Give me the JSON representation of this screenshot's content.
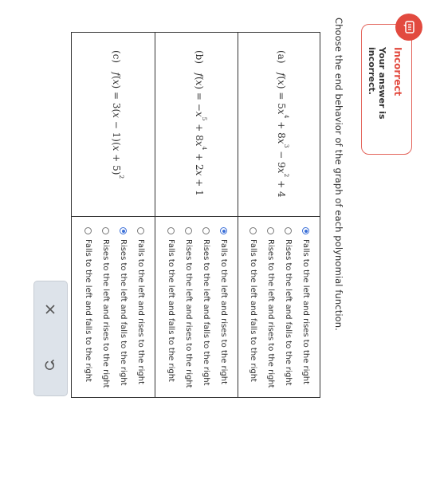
{
  "feedback": {
    "title": "Incorrect",
    "message": "Your answer is incorrect.",
    "icon": "speech-bubble-icon",
    "accent": "#e24a3f"
  },
  "prompt": "Choose the end behavior of the graph of each polynomial function.",
  "rows": [
    {
      "label": "(a)",
      "function_text": "f(x) = 5x^4 + 8x^3 − 9x^2 + 4",
      "options": [
        "Falls to the left and rises to the right",
        "Rises to the left and falls to the right",
        "Rises to the left and rises to the right",
        "Falls to the left and falls to the right"
      ],
      "selected": 0
    },
    {
      "label": "(b)",
      "function_text": "f(x) = −x^5 + 8x^4 + 2x + 1",
      "options": [
        "Falls to the left and rises to the right",
        "Rises to the left and falls to the right",
        "Rises to the left and rises to the right",
        "Falls to the left and falls to the right"
      ],
      "selected": 0
    },
    {
      "label": "(c)",
      "function_text": "f(x) = 3(x − 1)(x + 5)^2",
      "options": [
        "Falls to the left and rises to the right",
        "Rises to the left and falls to the right",
        "Rises to the left and rises to the right",
        "Falls to the left and falls to the right"
      ],
      "selected": 1
    }
  ],
  "toolbar": {
    "clear_icon": "close-icon",
    "undo_icon": "undo-icon"
  },
  "colors": {
    "radio_selected": "#3b6fd8",
    "toolbar_bg": "#dde3ea"
  }
}
